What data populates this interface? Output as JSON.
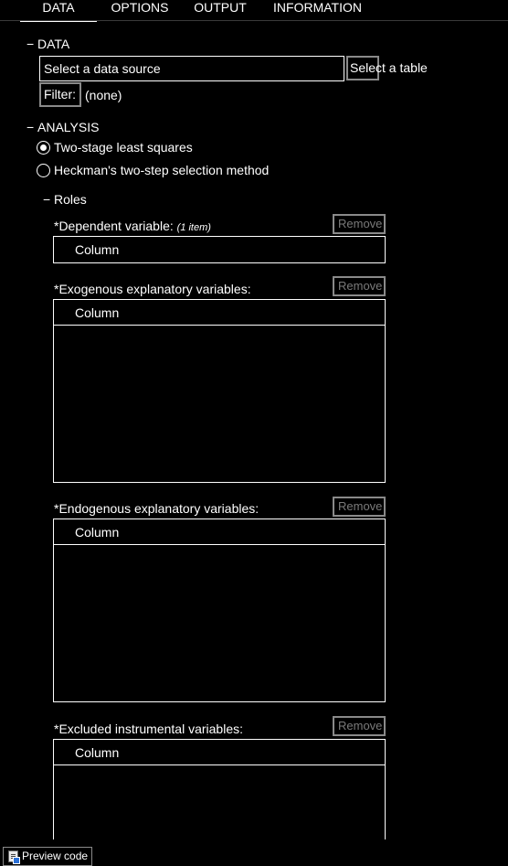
{
  "tabs": [
    {
      "label": "DATA",
      "active": true
    },
    {
      "label": "OPTIONS",
      "active": false
    },
    {
      "label": "OUTPUT",
      "active": false
    },
    {
      "label": "INFORMATION",
      "active": false
    }
  ],
  "data_section": {
    "toggle": "−",
    "title": "DATA",
    "data_source_placeholder": "Select a data source",
    "select_table_label": "Select a table",
    "filter_label": "Filter:",
    "filter_value": "(none)"
  },
  "analysis_section": {
    "toggle": "−",
    "title": "ANALYSIS",
    "methods": [
      {
        "label": "Two-stage least squares",
        "selected": true
      },
      {
        "label": "Heckman's two-step selection method",
        "selected": false
      }
    ]
  },
  "roles_section": {
    "toggle": "−",
    "title": "Roles",
    "dependent": {
      "label": "*Dependent variable:",
      "count": "(1 item)",
      "remove_label": "Remove",
      "column_header": "Column"
    },
    "exogenous": {
      "label": "*Exogenous explanatory variables:",
      "remove_label": "Remove",
      "column_header": "Column"
    },
    "endogenous": {
      "label": "*Endogenous explanatory variables:",
      "remove_label": "Remove",
      "column_header": "Column"
    },
    "excluded": {
      "label": "*Excluded instrumental variables:",
      "remove_label": "Remove",
      "column_header": "Column"
    }
  },
  "footer": {
    "preview_code_label": "Preview code"
  },
  "colors": {
    "background": "#000000",
    "text": "#ffffff",
    "disabled_text": "#7a7a7a",
    "button_border": "#8a8a8a"
  }
}
